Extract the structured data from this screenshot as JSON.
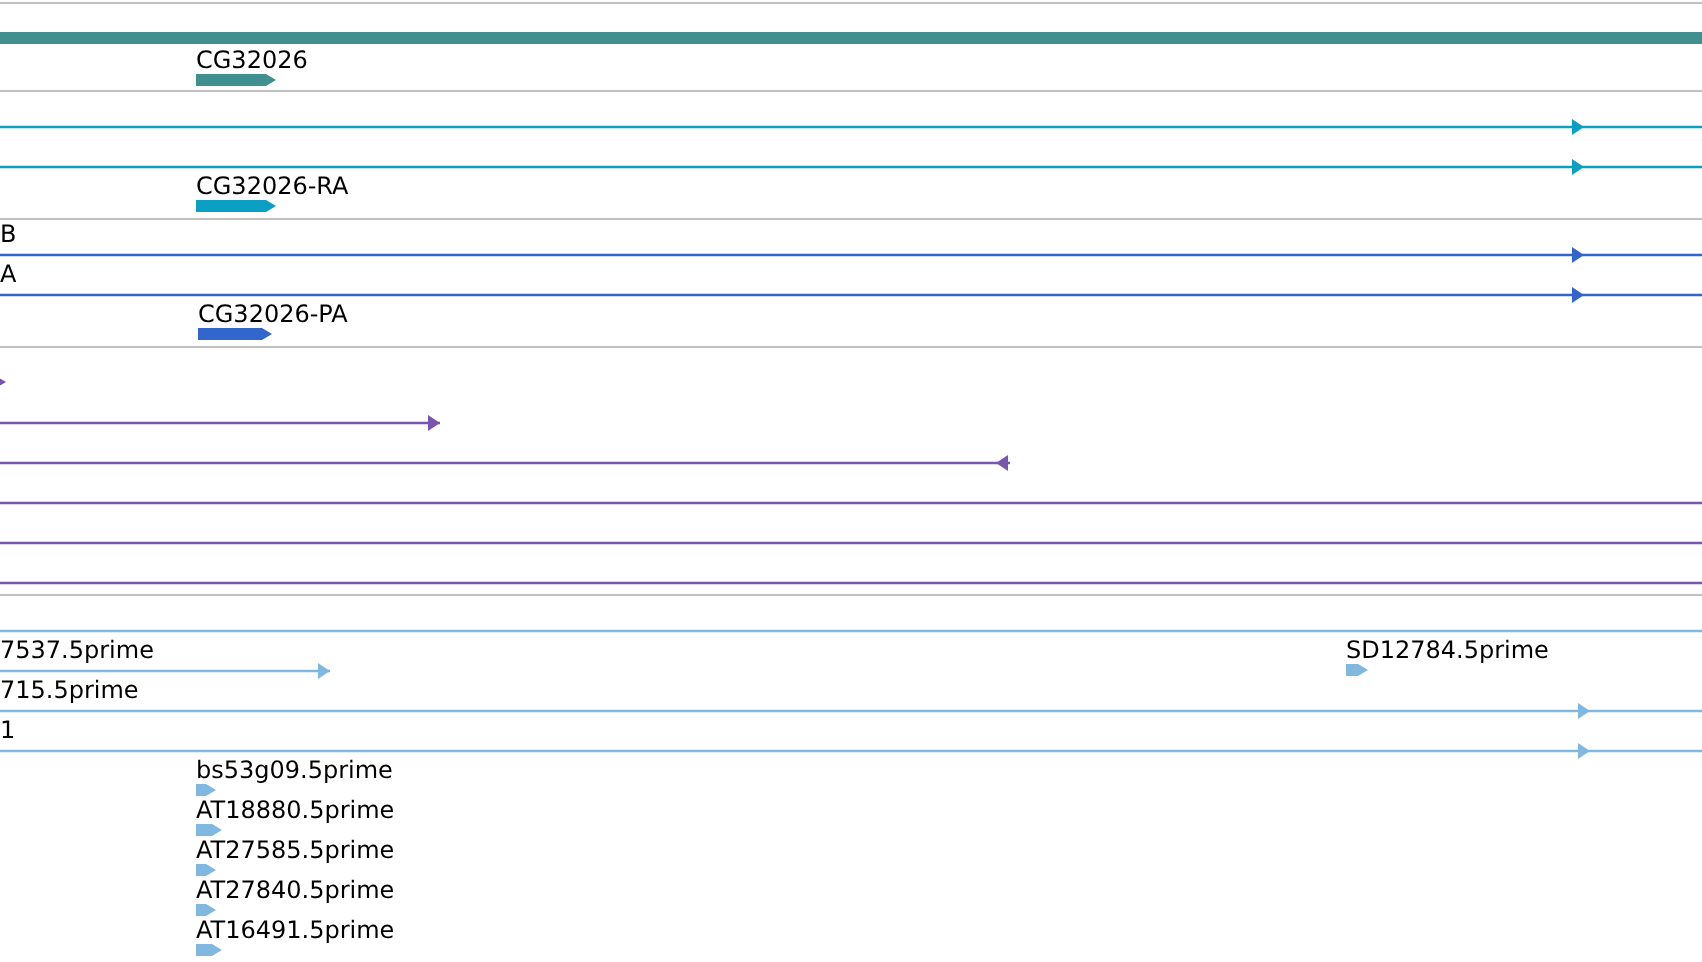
{
  "tracks": [
    {
      "color": "#418f8f",
      "rows": [
        {
          "features": [
            {
              "kind": "block",
              "reverse": false,
              "label": "CG32026"
            }
          ]
        }
      ]
    },
    {
      "color": "#0b9fc4",
      "rows": [
        {
          "features": [
            {
              "kind": "line",
              "reverse": false
            }
          ]
        },
        {
          "features": [
            {
              "kind": "line",
              "reverse": false
            }
          ]
        },
        {
          "features": [
            {
              "kind": "block",
              "reverse": false,
              "label": "CG32026-RA"
            }
          ]
        }
      ]
    },
    {
      "color": "#3366cc",
      "rows": [
        {
          "features": [
            {
              "kind": "line",
              "reverse": false,
              "label": "B"
            }
          ]
        },
        {
          "features": [
            {
              "kind": "line",
              "reverse": false,
              "label": "A"
            }
          ]
        },
        {
          "features": [
            {
              "kind": "block",
              "reverse": false,
              "label": "CG32026-PA"
            }
          ]
        }
      ]
    },
    {
      "color": "#7755b0",
      "rows": [
        {
          "features": [
            {
              "kind": "block",
              "reverse": false
            }
          ]
        },
        {
          "features": [
            {
              "kind": "line",
              "reverse": false
            }
          ]
        },
        {
          "features": [
            {
              "kind": "line",
              "reverse": true
            }
          ]
        },
        {
          "features": [
            {
              "kind": "line"
            }
          ]
        },
        {
          "features": [
            {
              "kind": "line"
            }
          ]
        },
        {
          "features": [
            {
              "kind": "line"
            }
          ]
        }
      ]
    },
    {
      "color": "#80b8e0",
      "rows": [
        {
          "features": [
            {
              "kind": "line"
            }
          ]
        },
        {
          "features": [
            {
              "kind": "line",
              "reverse": false,
              "label": "7537.5prime"
            },
            {
              "kind": "block",
              "reverse": false,
              "label": "SD12784.5prime"
            }
          ]
        },
        {
          "features": [
            {
              "kind": "line",
              "reverse": false,
              "label": "715.5prime"
            }
          ]
        },
        {
          "features": [
            {
              "kind": "line",
              "reverse": false,
              "label": "1"
            }
          ]
        },
        {
          "features": [
            {
              "kind": "block",
              "reverse": false,
              "label": "bs53g09.5prime"
            }
          ]
        },
        {
          "features": [
            {
              "kind": "block",
              "reverse": false,
              "label": "AT18880.5prime"
            }
          ]
        },
        {
          "features": [
            {
              "kind": "block",
              "reverse": false,
              "label": "AT27585.5prime"
            }
          ]
        },
        {
          "features": [
            {
              "kind": "block",
              "reverse": false,
              "label": "AT27840.5prime"
            }
          ]
        },
        {
          "features": [
            {
              "kind": "block",
              "reverse": false,
              "label": "AT16491.5prime"
            }
          ]
        }
      ]
    }
  ]
}
